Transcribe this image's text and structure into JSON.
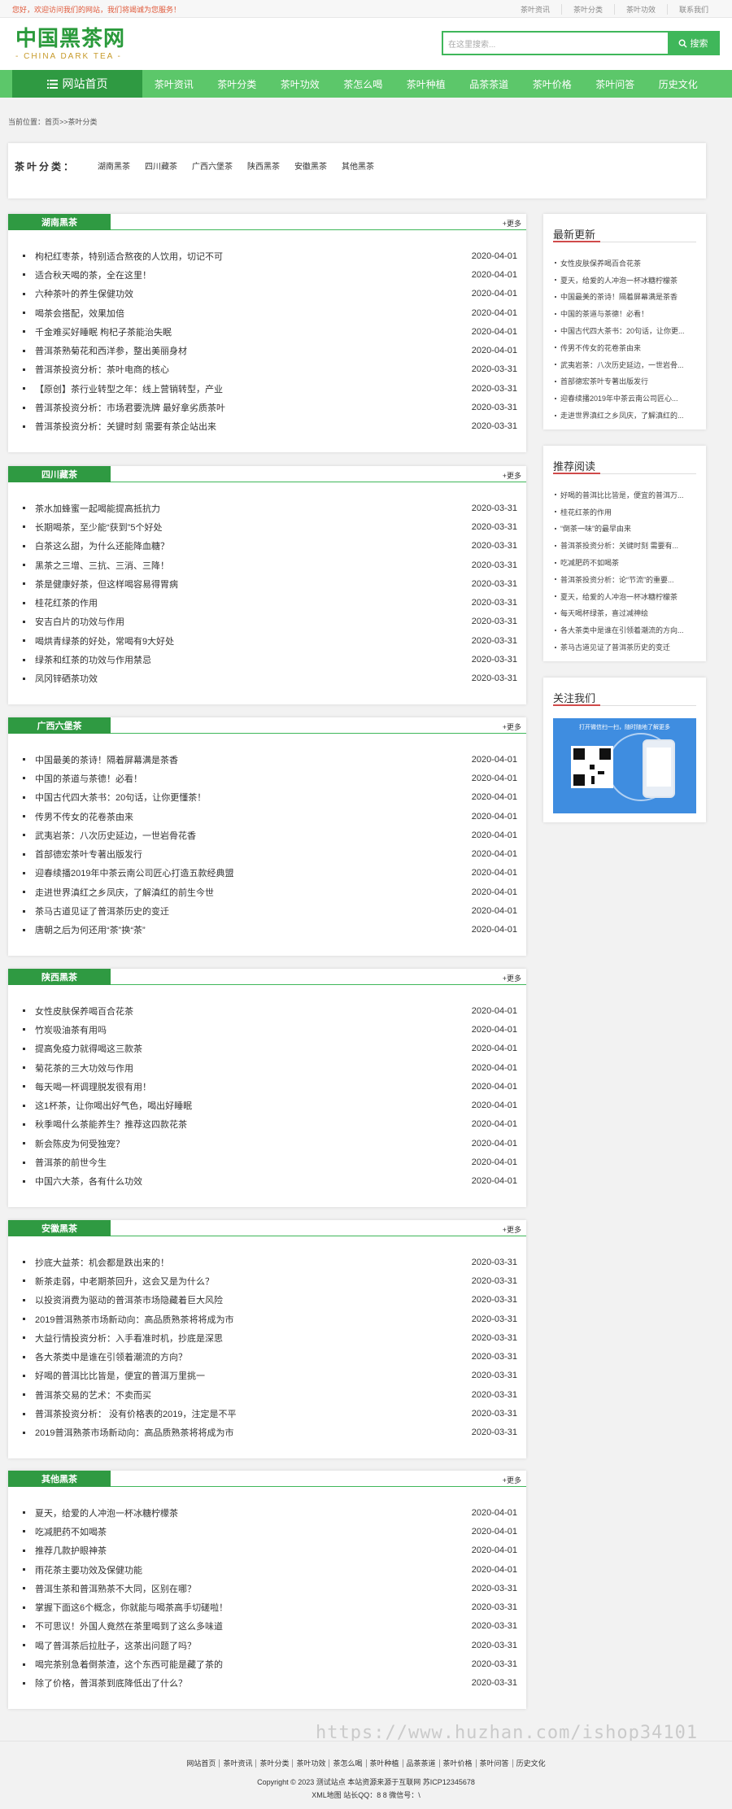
{
  "topbar": {
    "welcome": "您好，欢迎访问我们的网站，我们将竭诚为您服务！",
    "links": [
      "茶叶资讯",
      "茶叶分类",
      "茶叶功效",
      "联系我们"
    ]
  },
  "header": {
    "logo_cn": "中国黑茶网",
    "logo_en": "- CHINA DARK TEA -",
    "search_placeholder": "在这里搜索...",
    "search_button": "搜索"
  },
  "nav": {
    "home": "网站首页",
    "items": [
      "茶叶资讯",
      "茶叶分类",
      "茶叶功效",
      "茶怎么喝",
      "茶叶种植",
      "品茶茶道",
      "茶叶价格",
      "茶叶问答",
      "历史文化"
    ]
  },
  "breadcrumb": "当前位置：首页>>茶叶分类",
  "categories": {
    "label": "茶叶分类：",
    "items": [
      "湖南黑茶",
      "四川藏茶",
      "广西六堡茶",
      "陕西黑茶",
      "安徽黑茶",
      "其他黑茶"
    ]
  },
  "more_label": "+更多",
  "sections": [
    {
      "title": "湖南黑茶",
      "items": [
        {
          "t": "枸杞红枣茶，特别适合熬夜的人饮用，切记不可",
          "d": "2020-04-01"
        },
        {
          "t": "适合秋天喝的茶，全在这里！",
          "d": "2020-04-01"
        },
        {
          "t": "六种茶叶的养生保健功效",
          "d": "2020-04-01"
        },
        {
          "t": "喝茶会搭配，效果加倍",
          "d": "2020-04-01"
        },
        {
          "t": "千金难买好睡眠 枸杞子茶能治失眠",
          "d": "2020-04-01"
        },
        {
          "t": "普洱茶熟菊花和西洋参，整出美丽身材",
          "d": "2020-04-01"
        },
        {
          "t": "普洱茶投资分析：茶叶电商的核心",
          "d": "2020-03-31"
        },
        {
          "t": "【原创】茶行业转型之年：线上营销转型，产业",
          "d": "2020-03-31"
        },
        {
          "t": "普洱茶投资分析：市场君要洗牌 最好拿劣质茶叶",
          "d": "2020-03-31"
        },
        {
          "t": "普洱茶投资分析：关键时刻 需要有茶企站出来",
          "d": "2020-03-31"
        }
      ]
    },
    {
      "title": "四川藏茶",
      "items": [
        {
          "t": "茶水加蜂蜜一起喝能提高抵抗力",
          "d": "2020-03-31"
        },
        {
          "t": "长期喝茶，至少能“获到”5个好处",
          "d": "2020-03-31"
        },
        {
          "t": "白茶这么甜，为什么还能降血糖？",
          "d": "2020-03-31"
        },
        {
          "t": "黑茶之三增、三抗、三消、三降！",
          "d": "2020-03-31"
        },
        {
          "t": "茶是健康好茶，但这样喝容易得胃病",
          "d": "2020-03-31"
        },
        {
          "t": "桂花红茶的作用",
          "d": "2020-03-31"
        },
        {
          "t": "安吉白片的功效与作用",
          "d": "2020-03-31"
        },
        {
          "t": "喝烘青绿茶的好处，常喝有9大好处",
          "d": "2020-03-31"
        },
        {
          "t": "绿茶和红茶的功效与作用禁忌",
          "d": "2020-03-31"
        },
        {
          "t": "凤冈锌硒茶功效",
          "d": "2020-03-31"
        }
      ]
    },
    {
      "title": "广西六堡茶",
      "items": [
        {
          "t": "中国最美的茶诗！隔着屏幕满是茶香",
          "d": "2020-04-01"
        },
        {
          "t": "中国的茶道与茶德！必看！",
          "d": "2020-04-01"
        },
        {
          "t": "中国古代四大茶书：20句话，让你更懂茶！",
          "d": "2020-04-01"
        },
        {
          "t": "传男不传女的花卷茶由来",
          "d": "2020-04-01"
        },
        {
          "t": "武夷岩茶：八次历史延边，一世岩骨花香",
          "d": "2020-04-01"
        },
        {
          "t": "首部德宏茶叶专著出版发行",
          "d": "2020-04-01"
        },
        {
          "t": "迎春续播2019年中茶云南公司匠心打造五款经典盟",
          "d": "2020-04-01"
        },
        {
          "t": "走进世界滇红之乡凤庆，了解滇红的前生今世",
          "d": "2020-04-01"
        },
        {
          "t": "茶马古道见证了普洱茶历史的变迁",
          "d": "2020-04-01"
        },
        {
          "t": "唐朝之后为何还用“茶”换“茶”",
          "d": "2020-04-01"
        }
      ]
    },
    {
      "title": "陕西黑茶",
      "items": [
        {
          "t": "女性皮肤保养喝百合花茶",
          "d": "2020-04-01"
        },
        {
          "t": "竹炭吸油茶有用吗",
          "d": "2020-04-01"
        },
        {
          "t": "提高免疫力就得喝这三款茶",
          "d": "2020-04-01"
        },
        {
          "t": "菊花茶的三大功效与作用",
          "d": "2020-04-01"
        },
        {
          "t": "每天喝一杯调理脱发很有用！",
          "d": "2020-04-01"
        },
        {
          "t": "这1杯茶，让你喝出好气色，喝出好睡眠",
          "d": "2020-04-01"
        },
        {
          "t": "秋季喝什么茶能养生？推荐这四款花茶",
          "d": "2020-04-01"
        },
        {
          "t": "新会陈皮为何受独宠？",
          "d": "2020-04-01"
        },
        {
          "t": "普洱茶的前世今生",
          "d": "2020-04-01"
        },
        {
          "t": "中国六大茶，各有什么功效",
          "d": "2020-04-01"
        }
      ]
    },
    {
      "title": "安徽黑茶",
      "items": [
        {
          "t": "抄底大益茶：机会都是跌出来的！",
          "d": "2020-03-31"
        },
        {
          "t": "新茶走弱，中老期茶回升，这会又是为什么？",
          "d": "2020-03-31"
        },
        {
          "t": "以投资消费为驱动的普洱茶市场隐藏着巨大风险",
          "d": "2020-03-31"
        },
        {
          "t": "2019普洱熟茶市场新动向：高品质熟茶将将成为市",
          "d": "2020-03-31"
        },
        {
          "t": "大益行情投资分析：入手看准时机，抄底是深思",
          "d": "2020-03-31"
        },
        {
          "t": "各大茶类中是谁在引领着潮流的方向？",
          "d": "2020-03-31"
        },
        {
          "t": "好喝的普洱比比皆是，便宜的普洱万里挑一",
          "d": "2020-03-31"
        },
        {
          "t": "普洱茶交易的艺术：不卖而买",
          "d": "2020-03-31"
        },
        {
          "t": "普洱茶投资分析： 没有价格表的2019，注定是不平",
          "d": "2020-03-31"
        },
        {
          "t": "2019普洱熟茶市场新动向：高品质熟茶将将成为市",
          "d": "2020-03-31"
        }
      ]
    },
    {
      "title": "其他黑茶",
      "items": [
        {
          "t": "夏天，给爱的人冲泡一杯冰糖柠檬茶",
          "d": "2020-04-01"
        },
        {
          "t": "吃减肥药不如喝茶",
          "d": "2020-04-01"
        },
        {
          "t": "推荐几款护眼神茶",
          "d": "2020-04-01"
        },
        {
          "t": "雨花茶主要功效及保健功能",
          "d": "2020-04-01"
        },
        {
          "t": "普洱生茶和普洱熟茶不大同，区别在哪？",
          "d": "2020-03-31"
        },
        {
          "t": "掌握下面这6个概念，你就能与喝茶高手切磋啦！",
          "d": "2020-03-31"
        },
        {
          "t": "不可思议！外国人竟然在茶里喝到了这么多味道",
          "d": "2020-03-31"
        },
        {
          "t": "喝了普洱茶后拉肚子，这茶出问题了吗？",
          "d": "2020-03-31"
        },
        {
          "t": "喝完茶别急着倒茶渣，这个东西可能是藏了茶的",
          "d": "2020-03-31"
        },
        {
          "t": "除了价格，普洱茶到底降低出了什么？",
          "d": "2020-03-31"
        }
      ]
    }
  ],
  "sidebar": {
    "latest": {
      "title": "最新更新",
      "items": [
        "女性皮肤保养喝百合花茶",
        "夏天，给爱的人冲泡一杯冰糖柠檬茶",
        "中国最美的茶诗！隔着屏幕满是茶香",
        "中国的茶道与茶德！必看！",
        "中国古代四大茶书：20句话，让你更...",
        "传男不传女的花卷茶由来",
        "武夷岩茶：八次历史延边，一世岩骨...",
        "首部德宏茶叶专著出版发行",
        "迎春续播2019年中茶云南公司匠心...",
        "走进世界滇红之乡凤庆，了解滇红的..."
      ]
    },
    "recommended": {
      "title": "推荐阅读",
      "items": [
        "好喝的普洱比比皆是，便宜的普洱万...",
        "桂花红茶的作用",
        "“倒茶一味”的最早由来",
        "普洱茶投资分析：关键时刻 需要有...",
        "吃减肥药不如喝茶",
        "普洱茶投资分析：论“节流”的重要...",
        "夏天，给爱的人冲泡一杯冰糖柠檬茶",
        "每天喝杯绿茶，喜过减神绘",
        "各大茶类中是谁在引领着潮流的方向...",
        "茶马古道见证了普洱茶历史的变迁"
      ]
    },
    "follow": {
      "title": "关注我们",
      "qr_caption": "打开微信扫一扫，随时随地了解更多"
    }
  },
  "footer": {
    "links": [
      "网站首页",
      "茶叶资讯",
      "茶叶分类",
      "茶叶功效",
      "茶怎么喝",
      "茶叶种植",
      "品茶茶道",
      "茶叶价格",
      "茶叶问答",
      "历史文化"
    ],
    "copyright": "Copyright © 2023 测试站点 本站资源来源于互联网 苏ICP12345678",
    "xml": "XML地图 站长QQ：8        8 微信号：\\",
    "watermark": "https://www.huzhan.com/ishop34101"
  }
}
